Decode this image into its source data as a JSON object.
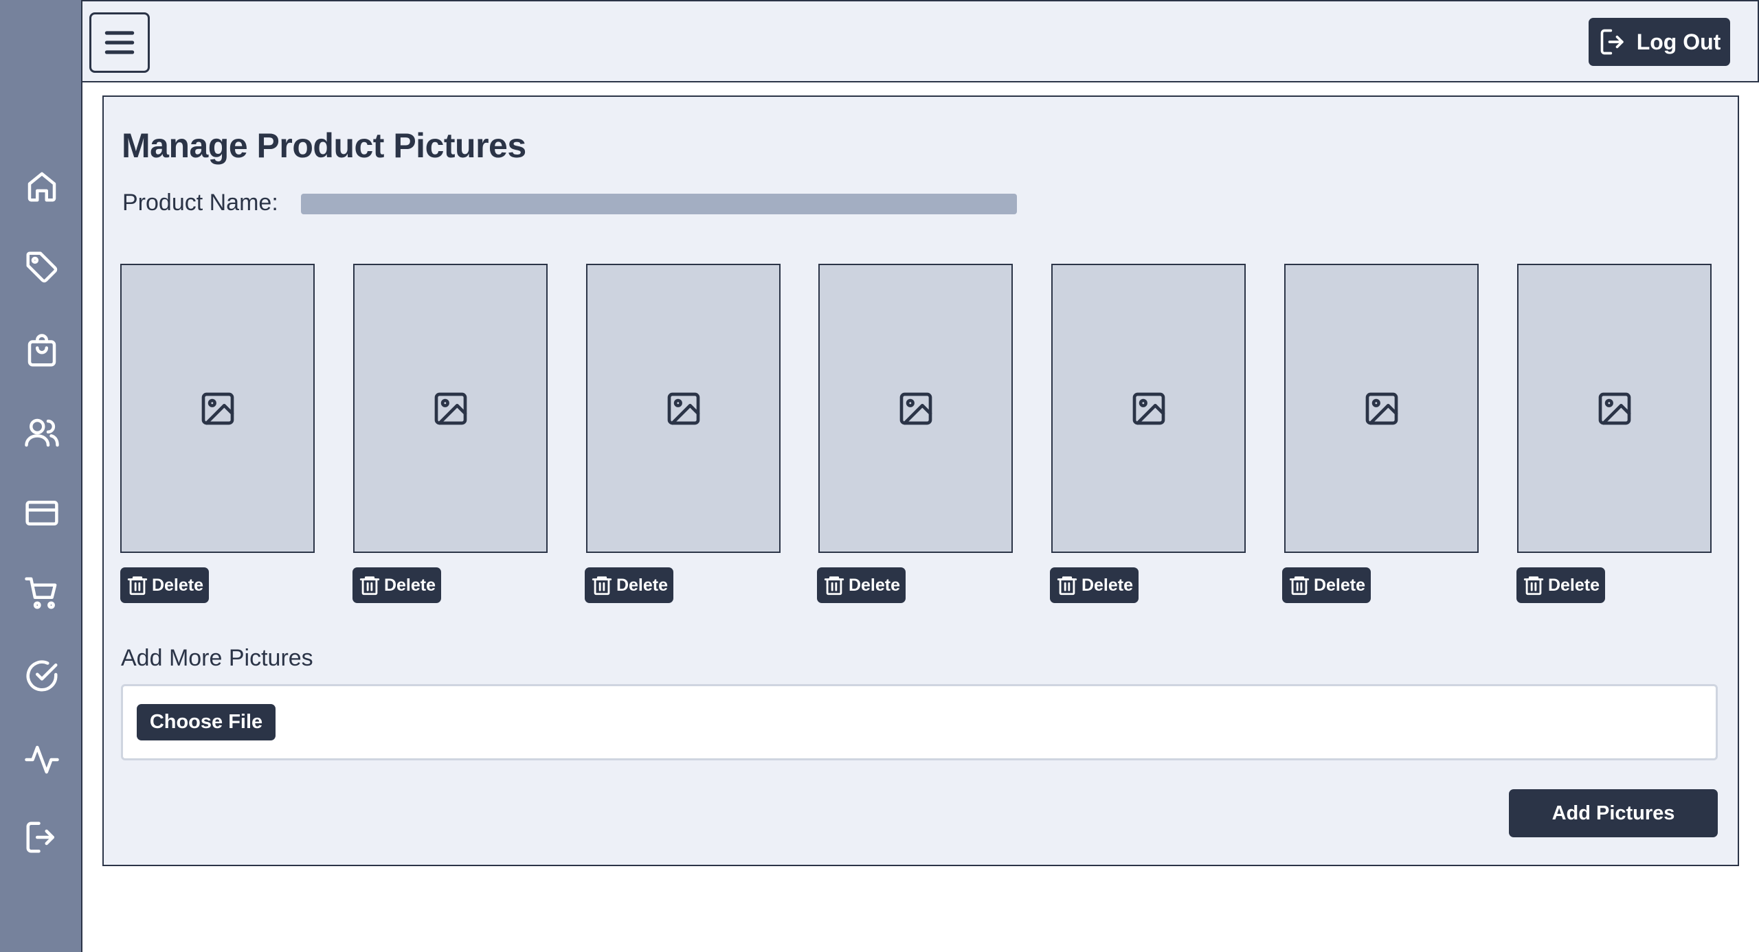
{
  "header": {
    "menu_icon": "menu-icon",
    "logout_label": "Log Out",
    "logout_icon": "logout-icon"
  },
  "sidebar": {
    "items": [
      {
        "name": "home",
        "icon": "home-icon"
      },
      {
        "name": "tags",
        "icon": "tag-icon"
      },
      {
        "name": "products",
        "icon": "shopping-bag-icon"
      },
      {
        "name": "users",
        "icon": "users-icon"
      },
      {
        "name": "payments",
        "icon": "credit-card-icon"
      },
      {
        "name": "cart",
        "icon": "cart-icon"
      },
      {
        "name": "approvals",
        "icon": "check-circle-icon"
      },
      {
        "name": "activity",
        "icon": "activity-icon"
      },
      {
        "name": "logout",
        "icon": "logout-icon"
      }
    ]
  },
  "main": {
    "title": "Manage Product Pictures",
    "product_name_label": "Product Name:",
    "product_name_value": "",
    "pictures": [
      {
        "delete_label": "Delete"
      },
      {
        "delete_label": "Delete"
      },
      {
        "delete_label": "Delete"
      },
      {
        "delete_label": "Delete"
      },
      {
        "delete_label": "Delete"
      },
      {
        "delete_label": "Delete"
      },
      {
        "delete_label": "Delete"
      }
    ],
    "add_more_label": "Add More Pictures",
    "choose_file_label": "Choose File",
    "add_pictures_label": "Add Pictures"
  },
  "colors": {
    "sidebar_bg": "#76829c",
    "panel_bg": "#edf0f7",
    "button_bg": "#2b3447",
    "placeholder_bg": "#cdd3df",
    "name_bar": "#a3aec2"
  }
}
